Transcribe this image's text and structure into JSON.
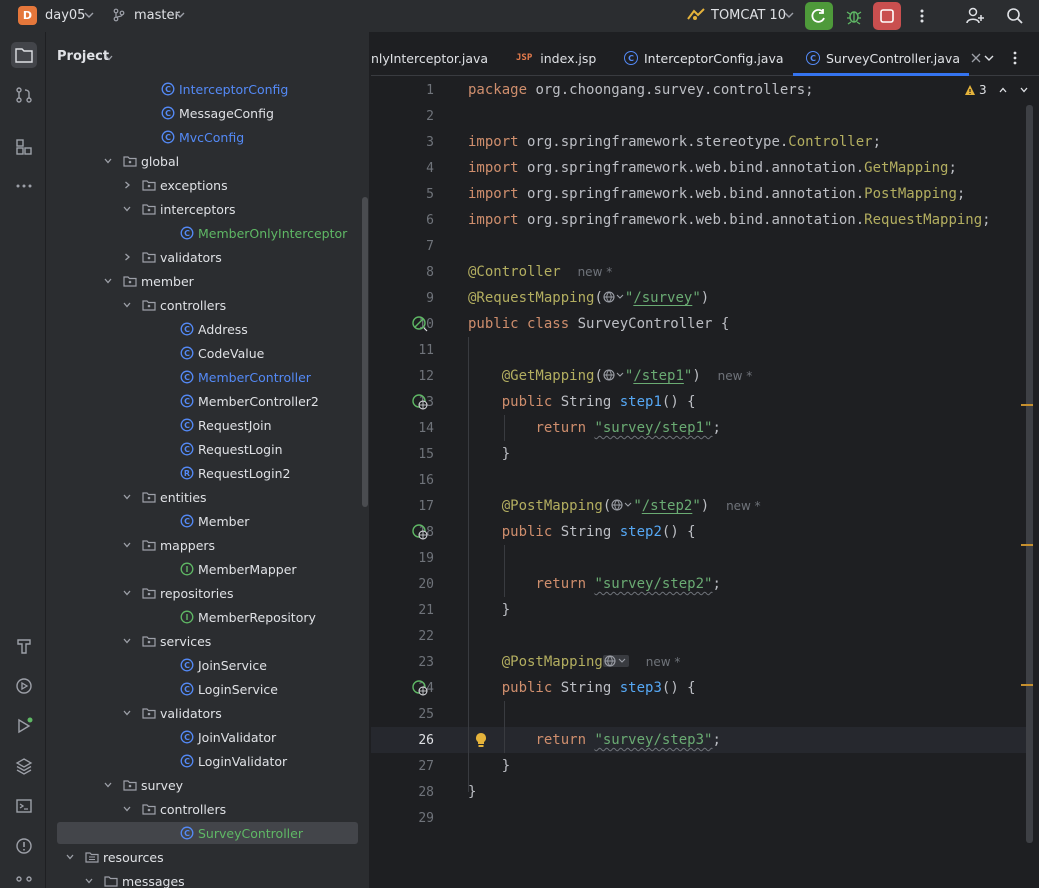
{
  "titlebar": {
    "project_badge": "D",
    "project_name": "day05",
    "branch": "master",
    "run_config": "TOMCAT 10"
  },
  "project_panel": {
    "title": "Project",
    "tree": [
      {
        "label": "InterceptorConfig",
        "kind": "class",
        "indent": 8,
        "color": "#548af7"
      },
      {
        "label": "MessageConfig",
        "kind": "class",
        "indent": 8,
        "color": "#dfe1e5"
      },
      {
        "label": "MvcConfig",
        "kind": "class",
        "indent": 8,
        "color": "#548af7"
      },
      {
        "label": "global",
        "kind": "package",
        "indent": 6,
        "arrow": "down"
      },
      {
        "label": "exceptions",
        "kind": "package",
        "indent": 7,
        "arrow": "right"
      },
      {
        "label": "interceptors",
        "kind": "package",
        "indent": 7,
        "arrow": "down"
      },
      {
        "label": "MemberOnlyInterceptor",
        "kind": "class",
        "indent": 9,
        "color": "#5fb865"
      },
      {
        "label": "validators",
        "kind": "package",
        "indent": 7,
        "arrow": "right"
      },
      {
        "label": "member",
        "kind": "package",
        "indent": 6,
        "arrow": "down"
      },
      {
        "label": "controllers",
        "kind": "package",
        "indent": 7,
        "arrow": "down"
      },
      {
        "label": "Address",
        "kind": "class",
        "indent": 9,
        "color": "#dfe1e5"
      },
      {
        "label": "CodeValue",
        "kind": "class",
        "indent": 9,
        "color": "#dfe1e5"
      },
      {
        "label": "MemberController",
        "kind": "class",
        "indent": 9,
        "color": "#548af7"
      },
      {
        "label": "MemberController2",
        "kind": "class",
        "indent": 9,
        "color": "#dfe1e5"
      },
      {
        "label": "RequestJoin",
        "kind": "class",
        "indent": 9,
        "color": "#dfe1e5"
      },
      {
        "label": "RequestLogin",
        "kind": "class",
        "indent": 9,
        "color": "#dfe1e5"
      },
      {
        "label": "RequestLogin2",
        "kind": "record",
        "indent": 9,
        "color": "#dfe1e5"
      },
      {
        "label": "entities",
        "kind": "package",
        "indent": 7,
        "arrow": "down"
      },
      {
        "label": "Member",
        "kind": "class",
        "indent": 9,
        "color": "#dfe1e5"
      },
      {
        "label": "mappers",
        "kind": "package",
        "indent": 7,
        "arrow": "down"
      },
      {
        "label": "MemberMapper",
        "kind": "interface",
        "indent": 9,
        "color": "#dfe1e5"
      },
      {
        "label": "repositories",
        "kind": "package",
        "indent": 7,
        "arrow": "down"
      },
      {
        "label": "MemberRepository",
        "kind": "interface",
        "indent": 9,
        "color": "#dfe1e5"
      },
      {
        "label": "services",
        "kind": "package",
        "indent": 7,
        "arrow": "down"
      },
      {
        "label": "JoinService",
        "kind": "class",
        "indent": 9,
        "color": "#dfe1e5"
      },
      {
        "label": "LoginService",
        "kind": "class",
        "indent": 9,
        "color": "#dfe1e5"
      },
      {
        "label": "validators",
        "kind": "package",
        "indent": 7,
        "arrow": "down"
      },
      {
        "label": "JoinValidator",
        "kind": "class",
        "indent": 9,
        "color": "#dfe1e5"
      },
      {
        "label": "LoginValidator",
        "kind": "class",
        "indent": 9,
        "color": "#dfe1e5"
      },
      {
        "label": "survey",
        "kind": "package",
        "indent": 6,
        "arrow": "down"
      },
      {
        "label": "controllers",
        "kind": "package",
        "indent": 7,
        "arrow": "down"
      },
      {
        "label": "SurveyController",
        "kind": "class",
        "indent": 9,
        "color": "#5fb865",
        "selected": true
      },
      {
        "label": "resources",
        "kind": "resfolder",
        "indent": 4,
        "arrow": "down"
      },
      {
        "label": "messages",
        "kind": "folder",
        "indent": 5,
        "arrow": "down"
      }
    ]
  },
  "tabs": [
    {
      "label": "nlyInterceptor.java",
      "icon": "none"
    },
    {
      "label": "index.jsp",
      "icon": "jsp"
    },
    {
      "label": "InterceptorConfig.java",
      "icon": "class"
    },
    {
      "label": "SurveyController.java",
      "icon": "class",
      "active": true
    }
  ],
  "jsp_icon_text": "JSP",
  "editor": {
    "warning_count": "3",
    "current_line": 26,
    "lines": [
      "1",
      "2",
      "3",
      "4",
      "5",
      "6",
      "7",
      "8",
      "9",
      "10",
      "11",
      "12",
      "13",
      "14",
      "15",
      "16",
      "17",
      "18",
      "19",
      "20",
      "21",
      "22",
      "23",
      "24",
      "25",
      "26",
      "27",
      "28",
      "29"
    ],
    "code": {
      "l1_kw": "package",
      "l1_rest": " org.choongang.survey.controllers;",
      "l3_kw": "import",
      "l3_pre": " org.springframework.stereotype.",
      "l3_ann": "Controller",
      "l4_kw": "import",
      "l4_pre": " org.springframework.web.bind.annotation.",
      "l4_ann": "GetMapping",
      "l5_kw": "import",
      "l5_pre": " org.springframework.web.bind.annotation.",
      "l5_ann": "PostMapping",
      "l6_kw": "import",
      "l6_pre": " org.springframework.web.bind.annotation.",
      "l6_ann": "RequestMapping",
      "semi": ";",
      "l8_ann": "@Controller",
      "hint_new": "new *",
      "l9_ann": "@RequestMapping",
      "l9_open": "(",
      "l9_str_q1": "\"",
      "l9_str": "/survey",
      "l9_str_q2": "\"",
      "l9_close": ")",
      "l10_kw": "public class",
      "l10_rest": " SurveyController {",
      "l12_ann": "@GetMapping",
      "l12_str": "/step1",
      "l13_kw": "public",
      "l13_type": " String ",
      "l13_fn": "step1",
      "l13_rest": "() {",
      "l14_kw": "return",
      "l14_str": "\"survey/step1\"",
      "l15": "}",
      "l17_ann": "@PostMapping",
      "l17_str": "/step2",
      "l18_fn": "step2",
      "l20_str": "\"survey/step2\"",
      "l23_ann": "@PostMapping",
      "l24_fn": "step3",
      "l26_str": "\"survey/step3\"",
      "l28": "}"
    }
  }
}
